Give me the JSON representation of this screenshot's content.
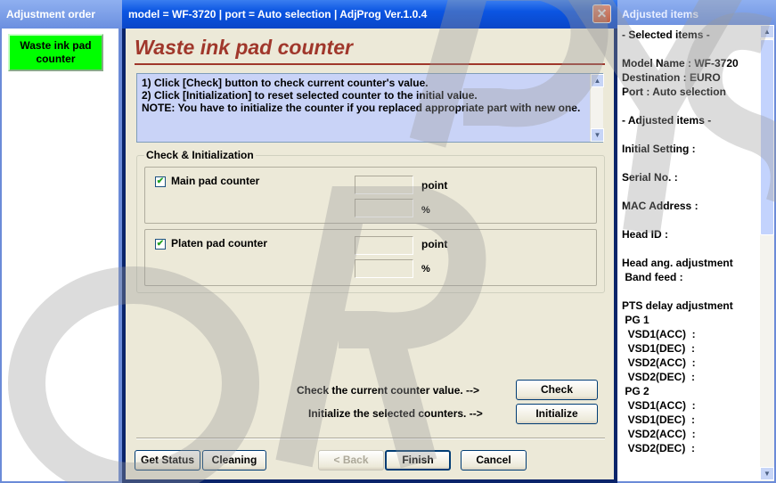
{
  "left_panel": {
    "title": "Adjustment order",
    "item_label_line1": "Waste ink pad",
    "item_label_line2": "counter",
    "item_color": "#00ff00"
  },
  "dialog": {
    "title": "model = WF-3720 | port = Auto selection | AdjProg Ver.1.0.4",
    "close_icon": "close-icon",
    "heading": "Waste ink pad counter",
    "notes": [
      "1) Click [Check] button to check current counter's value.",
      "2) Click [Initialization] to reset selected counter to the initial value.",
      "NOTE: You have to initialize the counter if you replaced appropriate part with new one."
    ],
    "group_label": "Check & Initialization",
    "counters": [
      {
        "label": "Main pad counter",
        "checked": true,
        "point_value": "",
        "percent_value": "",
        "unit_point": "point",
        "unit_percent": "%"
      },
      {
        "label": "Platen pad counter",
        "checked": true,
        "point_value": "",
        "percent_value": "",
        "unit_point": "point",
        "unit_percent": "%"
      }
    ],
    "check_text": "Check the current counter value. -->",
    "check_button": "Check",
    "init_text": "Initialize the selected counters. -->",
    "init_button": "Initialize",
    "footer": {
      "get_status": "Get Status",
      "cleaning": "Cleaning",
      "back": "< Back",
      "finish": "Finish",
      "cancel": "Cancel"
    },
    "accent_color": "#a0372b"
  },
  "right_panel": {
    "title": "Adjusted items",
    "lines": "- Selected items -\n\nModel Name : WF-3720\nDestination : EURO\nPort : Auto selection\n\n- Adjusted items -\n\nInitial Setting :\n\nSerial No. :\n\nMAC Address :\n\nHead ID :\n\nHead ang. adjustment\n Band feed :\n\nPTS delay adjustment\n PG 1\n  VSD1(ACC)  :\n  VSD1(DEC)  :\n  VSD2(ACC)  :\n  VSD2(DEC)  :\n PG 2\n  VSD1(ACC)  :\n  VSD1(DEC)  :\n  VSD2(ACC)  :\n  VSD2(DEC)  :"
  },
  "watermark_text": "ORPYS"
}
